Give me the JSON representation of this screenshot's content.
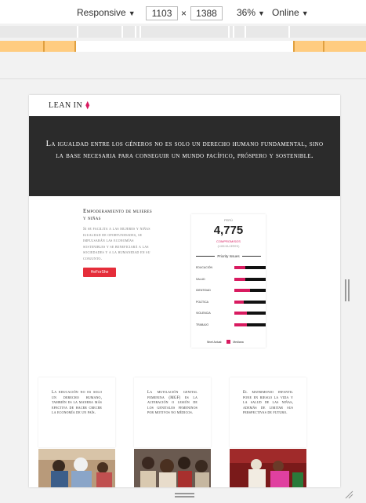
{
  "devtools": {
    "device_label": "Responsive",
    "width": "1103",
    "height": "1388",
    "dim_separator": "×",
    "zoom": "36%",
    "network": "Online"
  },
  "site": {
    "logo": "LEAN IN",
    "hero_text": "La igualdad entre los géneros no es solo un derecho humano fundamental, sino la base necesaria para conseguir un mundo pacífico, próspero y sostenible.",
    "empower_title": "Empoderamiento de mujeres y niñas",
    "empower_body": "Si se facilita a las mujeres y niñas igualdad de oportunidades, se impulsarán las economías sostenibles y se beneficiará a las sociedades y a la humanidad en su conjunto.",
    "cta": "HeForShe",
    "card": {
      "country": "PERÚ",
      "number": "4,775",
      "commitments": "COMPROMISOS",
      "sub": "(1455 MUJERES)",
      "priority": "Priority Issues",
      "rows": [
        {
          "label": "EDUCACIÓN",
          "fill": 0.35
        },
        {
          "label": "SALUD",
          "fill": 0.35
        },
        {
          "label": "IDENTIDAD",
          "fill": 0.5
        },
        {
          "label": "POLÍTICA",
          "fill": 0.3
        },
        {
          "label": "VIOLENCIA",
          "fill": 0.4
        },
        {
          "label": "TRABAJO",
          "fill": 0.4
        }
      ],
      "legend_a": "Nivel Actual:",
      "legend_b": "Mediana"
    },
    "boxes": [
      {
        "text": "La educación no es solo un derecho humano, también es la manera más efectiva de hacer crecer la economía de un país."
      },
      {
        "text": "La mutilación genital femenina (MGF) es la alteración o lesión de los genitales femeninos por motivos no médicos."
      },
      {
        "text": "El matrimonio infantil pone en riesgo la vida y la salud de las niñas, además de limitar sus perspectivas de futuro."
      }
    ]
  }
}
